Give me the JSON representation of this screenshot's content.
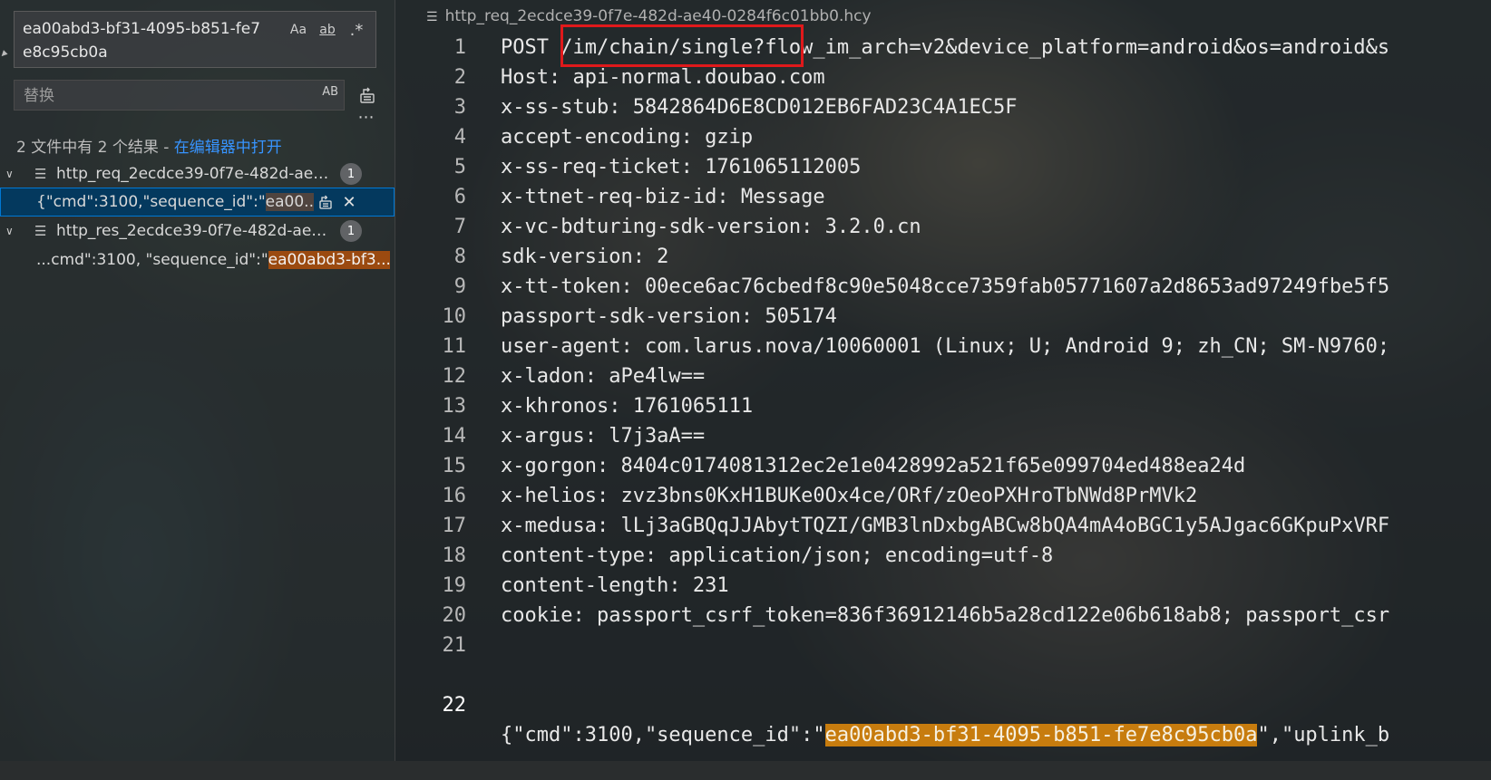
{
  "search": {
    "query": "ea00abd3-bf31-4095-b851-fe7e8c95cb0a",
    "option_match_case": "Aa",
    "option_whole_word": "ab",
    "option_regex": ".*",
    "replace_placeholder": "替换",
    "preserve_case": "AB",
    "summary_text": "2 文件中有 2 个结果 - ",
    "summary_link": "在编辑器中打开"
  },
  "results": [
    {
      "file": "http_req_2ecdce39-0f7e-482d-ae40...",
      "count": "1",
      "match_prefix": "{\"cmd\":3100,\"sequence_id\":\"",
      "match_highlight": "ea00...",
      "selected": true
    },
    {
      "file": "http_res_2ecdce39-0f7e-482d-ae40...",
      "count": "1",
      "match_prefix": "...cmd\":3100, \"sequence_id\":\"",
      "match_highlight": "ea00abd3-bf3...",
      "selected": false
    }
  ],
  "editor": {
    "breadcrumb": "http_req_2ecdce39-0f7e-482d-ae40-0284f6c01bb0.hcy",
    "lines": [
      {
        "n": "1",
        "text": "POST /im/chain/single?flow_im_arch=v2&device_platform=android&os=android&s"
      },
      {
        "n": "2",
        "text": "Host: api-normal.doubao.com"
      },
      {
        "n": "3",
        "text": "x-ss-stub: 5842864D6E8CD012EB6FAD23C4A1EC5F"
      },
      {
        "n": "4",
        "text": "accept-encoding: gzip"
      },
      {
        "n": "5",
        "text": "x-ss-req-ticket: 1761065112005"
      },
      {
        "n": "6",
        "text": "x-ttnet-req-biz-id: Message"
      },
      {
        "n": "7",
        "text": "x-vc-bdturing-sdk-version: 3.2.0.cn"
      },
      {
        "n": "8",
        "text": "sdk-version: 2"
      },
      {
        "n": "9",
        "text": "x-tt-token: 00ece6ac76cbedf8c90e5048cce7359fab05771607a2d8653ad97249fbe5f5"
      },
      {
        "n": "10",
        "text": "passport-sdk-version: 505174"
      },
      {
        "n": "11",
        "text": "user-agent: com.larus.nova/10060001 (Linux; U; Android 9; zh_CN; SM-N9760;"
      },
      {
        "n": "12",
        "text": "x-ladon: aPe4lw=="
      },
      {
        "n": "13",
        "text": "x-khronos: 1761065111"
      },
      {
        "n": "14",
        "text": "x-argus: l7j3aA=="
      },
      {
        "n": "15",
        "text": "x-gorgon: 8404c0174081312ec2e1e0428992a521f65e099704ed488ea24d"
      },
      {
        "n": "16",
        "text": "x-helios: zvz3bns0KxH1BUKe0Ox4ce/ORf/zOeoPXHroTbNWd8PrMVk2"
      },
      {
        "n": "17",
        "text": "x-medusa: lLj3aGBQqJJAbytTQZI/GMB3lnDxbgABCw8bQA4mA4oBGC1y5AJgac6GKpuPxVRF"
      },
      {
        "n": "18",
        "text": "content-type: application/json; encoding=utf-8"
      },
      {
        "n": "19",
        "text": "content-length: 231"
      },
      {
        "n": "20",
        "text": "cookie: passport_csrf_token=836f36912146b5a28cd122e06b618ab8; passport_csr"
      },
      {
        "n": "21",
        "text": ""
      }
    ],
    "last_line": {
      "n": "22",
      "before": "{\"cmd\":3100,\"sequence_id\":\"",
      "match": "ea00abd3-bf31-4095-b851-fe7e8c95cb0a",
      "after": "\",\"uplink_b"
    }
  },
  "colors": {
    "accent": "#0078d4",
    "link": "#3794ff",
    "match_highlight": "#c77c0e",
    "annotation_box": "#e0191b"
  },
  "icons": [
    "match-case-icon",
    "whole-word-icon",
    "regex-icon",
    "preserve-case-icon",
    "replace-all-icon",
    "more-icon",
    "chevron-down-icon",
    "file-icon",
    "replace-icon",
    "close-icon"
  ]
}
